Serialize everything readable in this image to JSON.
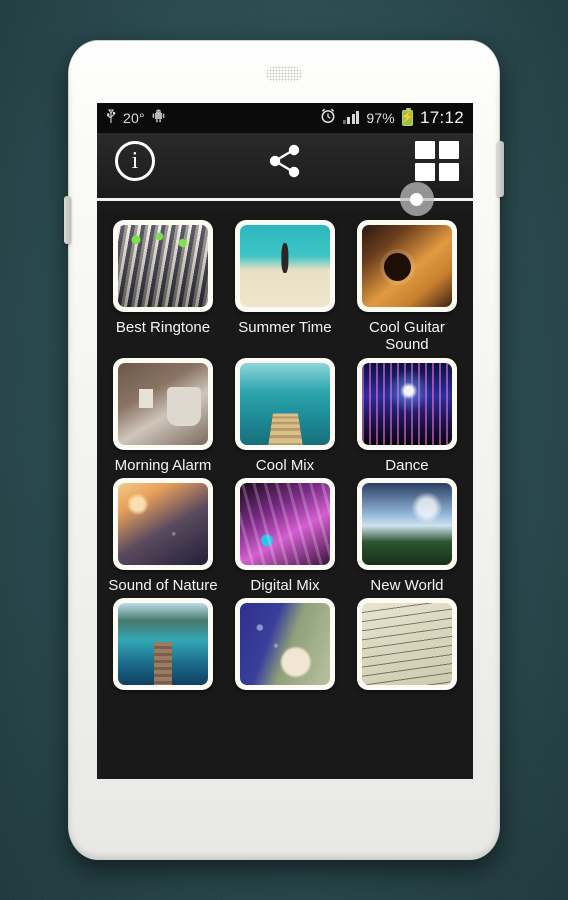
{
  "wallpaper": {
    "color": "#2b4d52"
  },
  "device": {
    "body_color": "#fbfbf9"
  },
  "status_bar": {
    "usb_icon": "usb-icon",
    "temperature": "20°",
    "android_icon": "android-robot-icon",
    "alarm_icon": "alarm-clock-icon",
    "signal_icon": "signal-bars-icon",
    "battery_percent": "97%",
    "battery_icon": "battery-charging-icon",
    "battery_glyph": "⚡",
    "clock": "17:12"
  },
  "action_bar": {
    "info_label": "i",
    "info_icon": "info-circle-icon",
    "share_icon": "share-icon",
    "grid_icon": "grid-view-icon"
  },
  "indicator": {
    "knob_position_percent": 85,
    "line_color": "#f2f2f2",
    "knob_color": "#bebebe"
  },
  "grid": {
    "rows": [
      [
        {
          "title": "Best Ringtone",
          "art": "art-mixer",
          "name": "grid-item-best-ringtone"
        },
        {
          "title": "Summer Time",
          "art": "art-beach",
          "name": "grid-item-summer-time"
        },
        {
          "title": "Cool Guitar Sound",
          "art": "art-guitar",
          "name": "grid-item-cool-guitar-sound"
        }
      ],
      [
        {
          "title": "Morning Alarm",
          "art": "art-coffee",
          "name": "grid-item-morning-alarm"
        },
        {
          "title": "Cool Mix",
          "art": "art-dock",
          "name": "grid-item-cool-mix"
        },
        {
          "title": "Dance",
          "art": "art-dance",
          "name": "grid-item-dance"
        }
      ],
      [
        {
          "title": "Sound of Nature",
          "art": "art-nature",
          "name": "grid-item-sound-of-nature"
        },
        {
          "title": "Digital Mix",
          "art": "art-digital",
          "name": "grid-item-digital-mix"
        },
        {
          "title": "New World",
          "art": "art-world",
          "name": "grid-item-new-world"
        }
      ],
      [
        {
          "title": "",
          "art": "art-tropic",
          "name": "grid-item-row4-1"
        },
        {
          "title": "",
          "art": "art-rain",
          "name": "grid-item-row4-2"
        },
        {
          "title": "",
          "art": "art-sheet",
          "name": "grid-item-row4-3"
        }
      ]
    ]
  },
  "nav_bar": {
    "back_icon": "back-arrow-icon",
    "home_icon": "home-icon",
    "recents_icon": "recent-apps-icon"
  }
}
